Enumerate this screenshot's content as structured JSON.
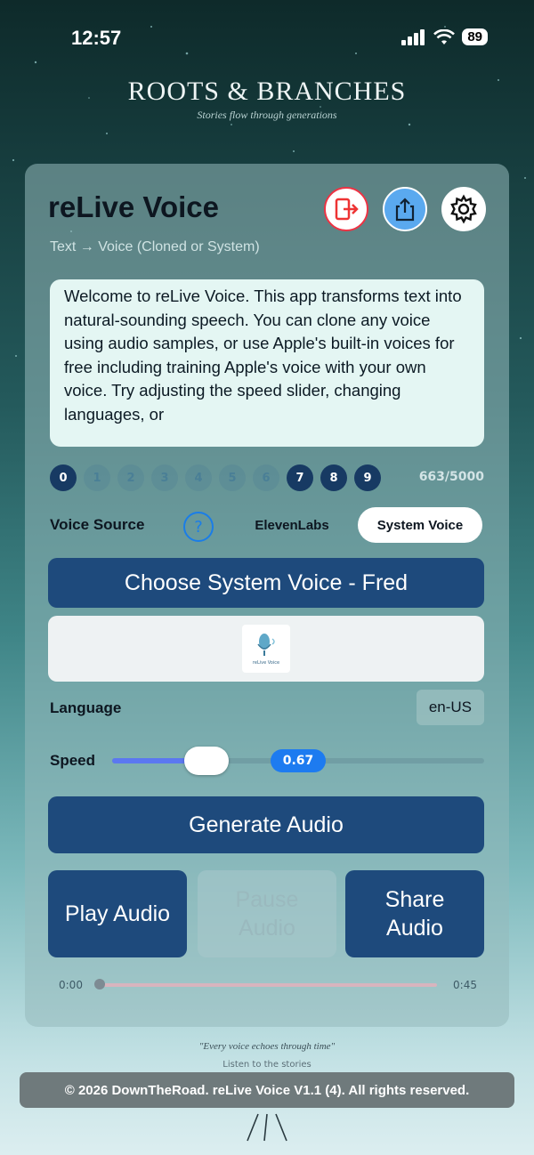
{
  "status_bar": {
    "time": "12:57",
    "battery": "89"
  },
  "brand": {
    "title": "ROOTS & BRANCHES",
    "tagline": "Stories flow through generations"
  },
  "app": {
    "title": "reLive Voice",
    "subtitle": "Text → Voice (Cloned or System)",
    "header_icons": [
      "logout-icon",
      "share-icon",
      "gear-icon"
    ]
  },
  "text_input": {
    "value": "Welcome to reLive Voice. This app transforms text into natural-sounding speech. You can clone any voice using audio samples, or use Apple's built-in voices for free including training Apple's voice with your own voice. Try adjusting the speed slider, changing languages, or"
  },
  "pagination": {
    "pages": [
      "0",
      "1",
      "2",
      "3",
      "4",
      "5",
      "6",
      "7",
      "8",
      "9"
    ],
    "active": [
      true,
      false,
      false,
      false,
      false,
      false,
      false,
      true,
      true,
      true
    ],
    "char_count": "663/5000"
  },
  "voice_source": {
    "label": "Voice Source",
    "help": "?",
    "options": [
      "ElevenLabs",
      "System Voice"
    ],
    "selected": "System Voice"
  },
  "choose_voice_label": "Choose System Voice - Fred",
  "preview_logo_text": "reLive Voice",
  "language": {
    "label": "Language",
    "value": "en-US"
  },
  "speed": {
    "label": "Speed",
    "value": "0.67",
    "fraction": 0.22
  },
  "buttons": {
    "generate": "Generate Audio",
    "play": "Play Audio",
    "pause": "Pause Audio",
    "share": "Share Audio"
  },
  "playback": {
    "current": "0:00",
    "duration": "0:45",
    "progress": 0.0
  },
  "footer": {
    "quote": "\"Every voice echoes through time\"",
    "listen": "Listen to the stories",
    "copyright": "© 2026 DownTheRoad. reLive Voice V1.1 (4). All rights reserved."
  },
  "colors": {
    "accent": "#1e4a7c",
    "help": "#1a7de8",
    "slider": "#5b78f0",
    "badge": "#1d7bf0"
  }
}
